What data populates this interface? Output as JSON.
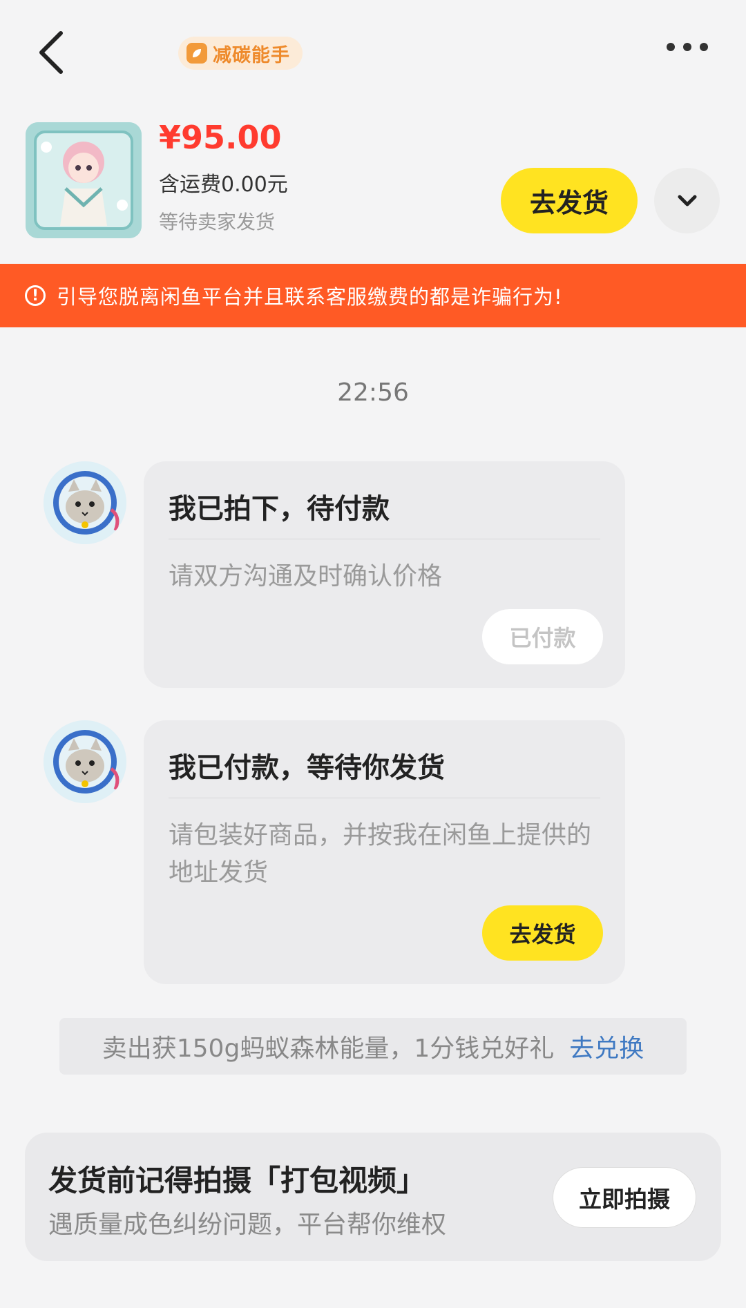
{
  "header": {
    "badge_label": "减碳能手",
    "back_icon": "chevron-left-icon",
    "more_icon": "more-horizontal-icon"
  },
  "product": {
    "price": "¥95.00",
    "shipping": "含运费0.00元",
    "status": "等待卖家发货",
    "ship_button": "去发货",
    "expand_icon": "chevron-down-icon"
  },
  "warning": {
    "text": "引导您脱离闲鱼平台并且联系客服缴费的都是诈骗行为!"
  },
  "chat": {
    "timestamp": "22:56",
    "messages": [
      {
        "title": "我已拍下，待付款",
        "body": "请双方沟通及时确认价格",
        "button": "已付款"
      },
      {
        "title": "我已付款，等待你发货",
        "body": "请包装好商品，并按我在闲鱼上提供的地址发货",
        "button": "去发货"
      }
    ]
  },
  "energy": {
    "text": "卖出获150g蚂蚁森林能量，1分钱兑好礼",
    "link": "去兑换"
  },
  "video_tip": {
    "title": "发货前记得拍摄「打包视频」",
    "subtitle": "遇质量成色纠纷问题，平台帮你维权",
    "button": "立即拍摄"
  },
  "colors": {
    "accent_yellow": "#ffe321",
    "price_red": "#ff3b2f",
    "warning_orange": "#ff5a25",
    "link_blue": "#3f79c2"
  }
}
